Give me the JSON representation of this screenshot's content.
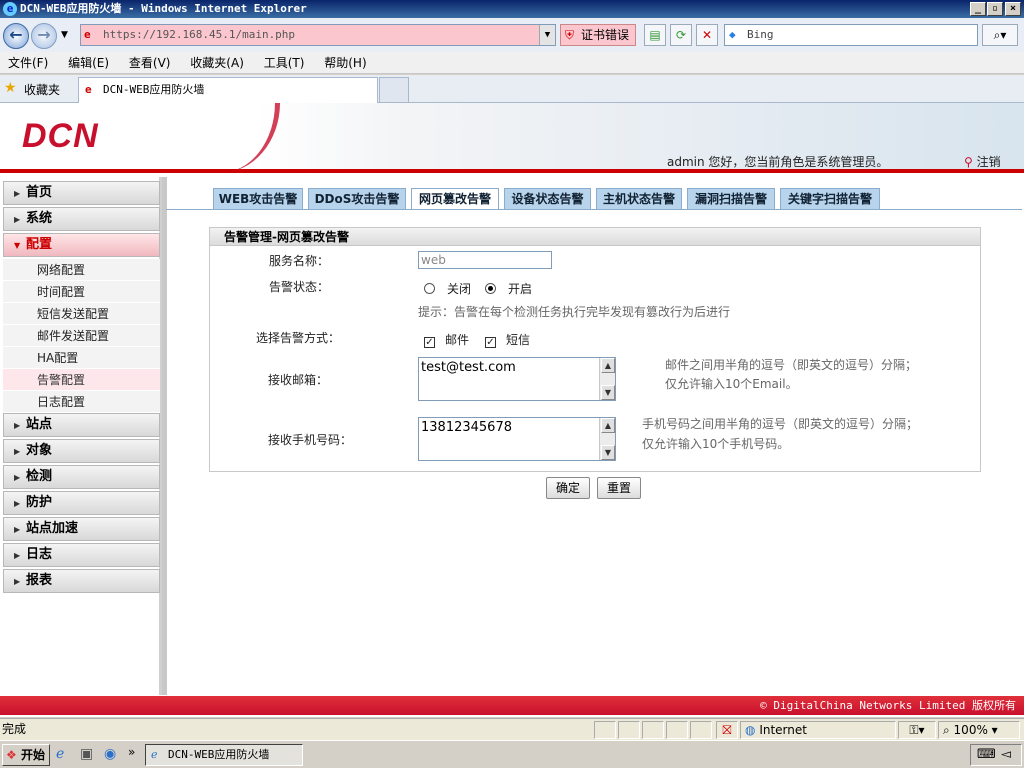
{
  "window": {
    "title": "DCN-WEB应用防火墙 - Windows Internet Explorer"
  },
  "browser": {
    "url": "https://192.168.45.1/main.php",
    "cert_error": "证书错误",
    "search_placeholder": "Bing",
    "menu": [
      "文件(F)",
      "编辑(E)",
      "查看(V)",
      "收藏夹(A)",
      "工具(T)",
      "帮助(H)"
    ],
    "favorites_label": "收藏夹",
    "tab_title": "DCN-WEB应用防火墙"
  },
  "header": {
    "logo": "DCN",
    "welcome": "admin 您好，您当前角色是系统管理员。",
    "logout": "注销"
  },
  "sidebar": {
    "sections_top": [
      {
        "label": "首页"
      },
      {
        "label": "系统"
      }
    ],
    "active_section": "配置",
    "subitems": [
      "网络配置",
      "时间配置",
      "短信发送配置",
      "邮件发送配置",
      "HA配置",
      "告警配置",
      "日志配置"
    ],
    "sections_bottom": [
      {
        "label": "站点"
      },
      {
        "label": "对象"
      },
      {
        "label": "检测"
      },
      {
        "label": "防护"
      },
      {
        "label": "站点加速"
      },
      {
        "label": "日志"
      },
      {
        "label": "报表"
      }
    ]
  },
  "tabs": [
    "WEB攻击告警",
    "DDoS攻击告警",
    "网页篡改告警",
    "设备状态告警",
    "主机状态告警",
    "漏洞扫描告警",
    "关键字扫描告警"
  ],
  "active_tab": "网页篡改告警",
  "form": {
    "panel_title": "告警管理-网页篡改告警",
    "service_name_label": "服务名称：",
    "service_name_value": "web",
    "status_label": "告警状态：",
    "status_off": "关闭",
    "status_on": "开启",
    "status_value": "开启",
    "hint": "提示：告警在每个检测任务执行完毕发现有篡改行为后进行",
    "method_label": "选择告警方式：",
    "method_mail": "邮件",
    "method_sms": "短信",
    "method_mail_checked": true,
    "method_sms_checked": true,
    "email_label": "接收邮箱：",
    "email_value": "test@test.com",
    "email_note_1": "邮件之间用半角的逗号（即英文的逗号）分隔；",
    "email_note_2": "仅允许输入10个Email。",
    "phone_label": "接收手机号码：",
    "phone_value": "13812345678",
    "phone_note_1": "手机号码之间用半角的逗号（即英文的逗号）分隔；",
    "phone_note_2": "仅允许输入10个手机号码。",
    "confirm": "确定",
    "reset": "重置"
  },
  "footer": "© DigitalChina Networks Limited 版权所有",
  "statusbar": {
    "left": "完成",
    "zone": "Internet",
    "zoom": "100%"
  },
  "taskbar": {
    "start": "开始",
    "task": "DCN-WEB应用防火墙 -..."
  }
}
